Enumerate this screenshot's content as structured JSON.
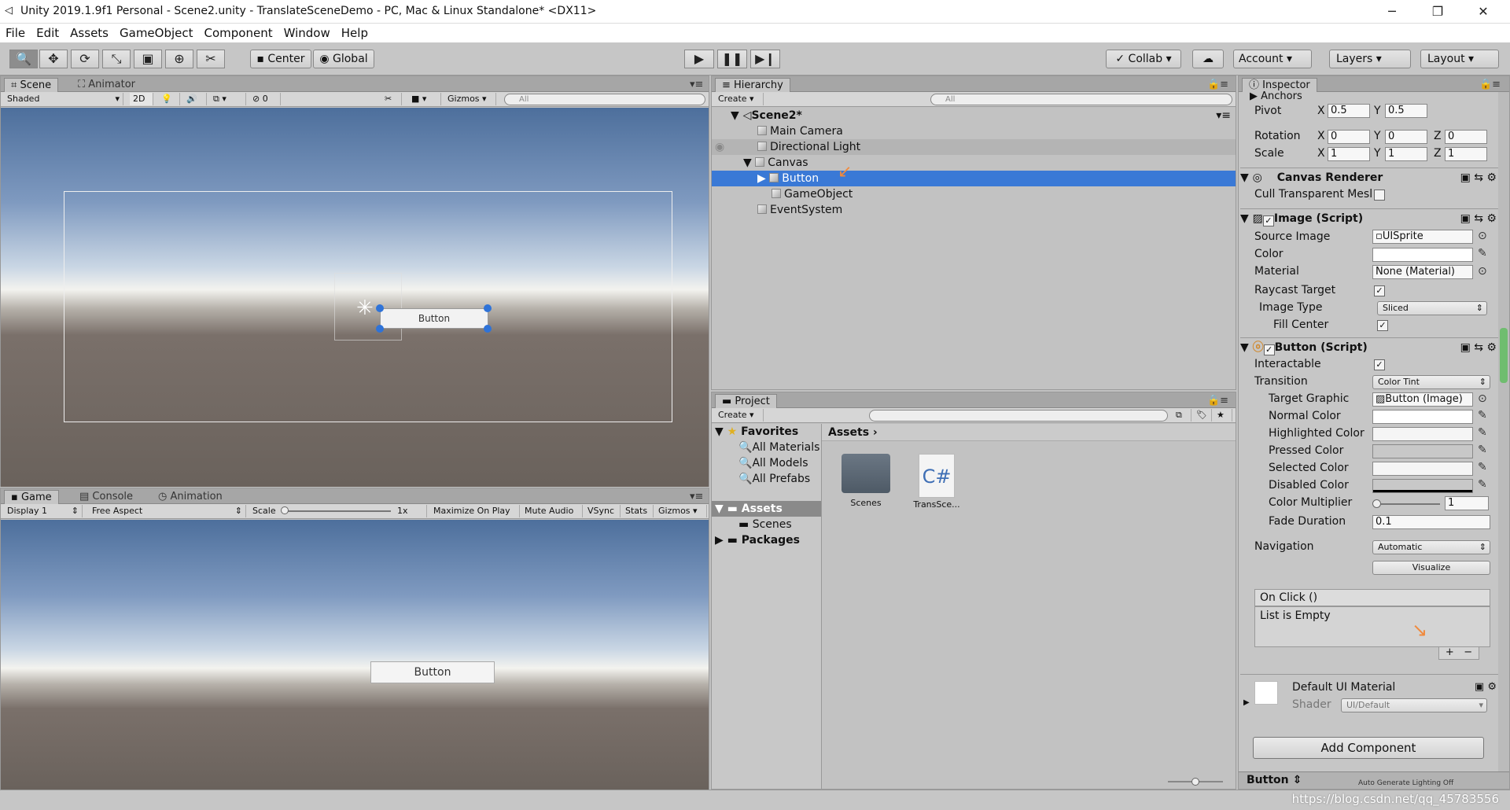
{
  "window": {
    "title": "Unity 2019.1.9f1 Personal - Scene2.unity - TranslateSceneDemo - PC, Mac & Linux Standalone* <DX11>"
  },
  "menu": [
    "File",
    "Edit",
    "Assets",
    "GameObject",
    "Component",
    "Window",
    "Help"
  ],
  "toolbar": {
    "center": "Center",
    "global": "Global",
    "collab": "Collab",
    "account": "Account",
    "layers": "Layers",
    "layout": "Layout"
  },
  "scene": {
    "tabs": [
      "Scene",
      "Animator"
    ],
    "shading": "Shaded",
    "mode2d": "2D",
    "hidden_count": "0",
    "gizmos": "Gizmos",
    "search_placeholder": "All",
    "button_label": "Button"
  },
  "game": {
    "tabs": [
      "Game",
      "Console",
      "Animation"
    ],
    "display": "Display 1",
    "aspect": "Free Aspect",
    "scale_label": "Scale",
    "scale_value": "1x",
    "scale_fraction": 0.0,
    "maximize": "Maximize On Play",
    "mute": "Mute Audio",
    "vsync": "VSync",
    "stats": "Stats",
    "gizmos": "Gizmos",
    "button_label": "Button"
  },
  "hierarchy": {
    "tab": "Hierarchy",
    "create": "Create",
    "search_placeholder": "All",
    "scene_name": "Scene2*",
    "items": [
      {
        "label": "Main Camera"
      },
      {
        "label": "Directional Light"
      },
      {
        "label": "Canvas"
      },
      {
        "label": "Button"
      },
      {
        "label": "GameObject"
      },
      {
        "label": "EventSystem"
      }
    ]
  },
  "project": {
    "tab": "Project",
    "create": "Create",
    "favorites": "Favorites",
    "fav_items": [
      "All Materials",
      "All Models",
      "All Prefabs"
    ],
    "assets": "Assets",
    "asset_folders": [
      "Scenes"
    ],
    "packages": "Packages",
    "breadcrumb": "Assets",
    "grid_items": [
      {
        "label": "Scenes"
      },
      {
        "label": "TransSce..."
      }
    ]
  },
  "inspector": {
    "tab": "Inspector",
    "anchors": "Anchors",
    "pivot_label": "Pivot",
    "pivot_x": "0.5",
    "pivot_y": "0.5",
    "rotation_label": "Rotation",
    "rot_x": "0",
    "rot_y": "0",
    "rot_z": "0",
    "scale_label": "Scale",
    "scale_x": "1",
    "scale_y": "1",
    "scale_z": "1",
    "canvas_renderer": "Canvas Renderer",
    "cull_label": "Cull Transparent Mesl",
    "image_script": "Image (Script)",
    "source_image_label": "Source Image",
    "source_image": "UISprite",
    "color_label": "Color",
    "material_label": "Material",
    "material": "None (Material)",
    "raycast_label": "Raycast Target",
    "image_type_label": "Image Type",
    "image_type": "Sliced",
    "fill_center_label": "Fill Center",
    "button_script": "Button (Script)",
    "interactable_label": "Interactable",
    "transition_label": "Transition",
    "transition": "Color Tint",
    "target_graphic_label": "Target Graphic",
    "target_graphic": "Button (Image)",
    "normal_color_label": "Normal Color",
    "highlighted_color_label": "Highlighted Color",
    "pressed_color_label": "Pressed Color",
    "selected_color_label": "Selected Color",
    "disabled_color_label": "Disabled Color",
    "color_multiplier_label": "Color Multiplier",
    "color_multiplier": "1",
    "fade_duration_label": "Fade Duration",
    "fade_duration": "0.1",
    "navigation_label": "Navigation",
    "navigation": "Automatic",
    "visualize": "Visualize",
    "onclick": "On Click ()",
    "list_empty": "List is Empty",
    "plus": "+",
    "minus": "−",
    "material_name": "Default UI Material",
    "shader_label": "Shader",
    "shader": "UI/Default",
    "add_component": "Add Component",
    "preview_label": "Button",
    "auto_lighting": "Auto Generate Lighting Off"
  },
  "watermark": "https://blog.csdn.net/qq_45783556",
  "colors": {
    "selection": "#3a79d6",
    "arrow": "#f08a3e",
    "sky_top": "#5a7fb0",
    "ground": "#6e6660"
  }
}
